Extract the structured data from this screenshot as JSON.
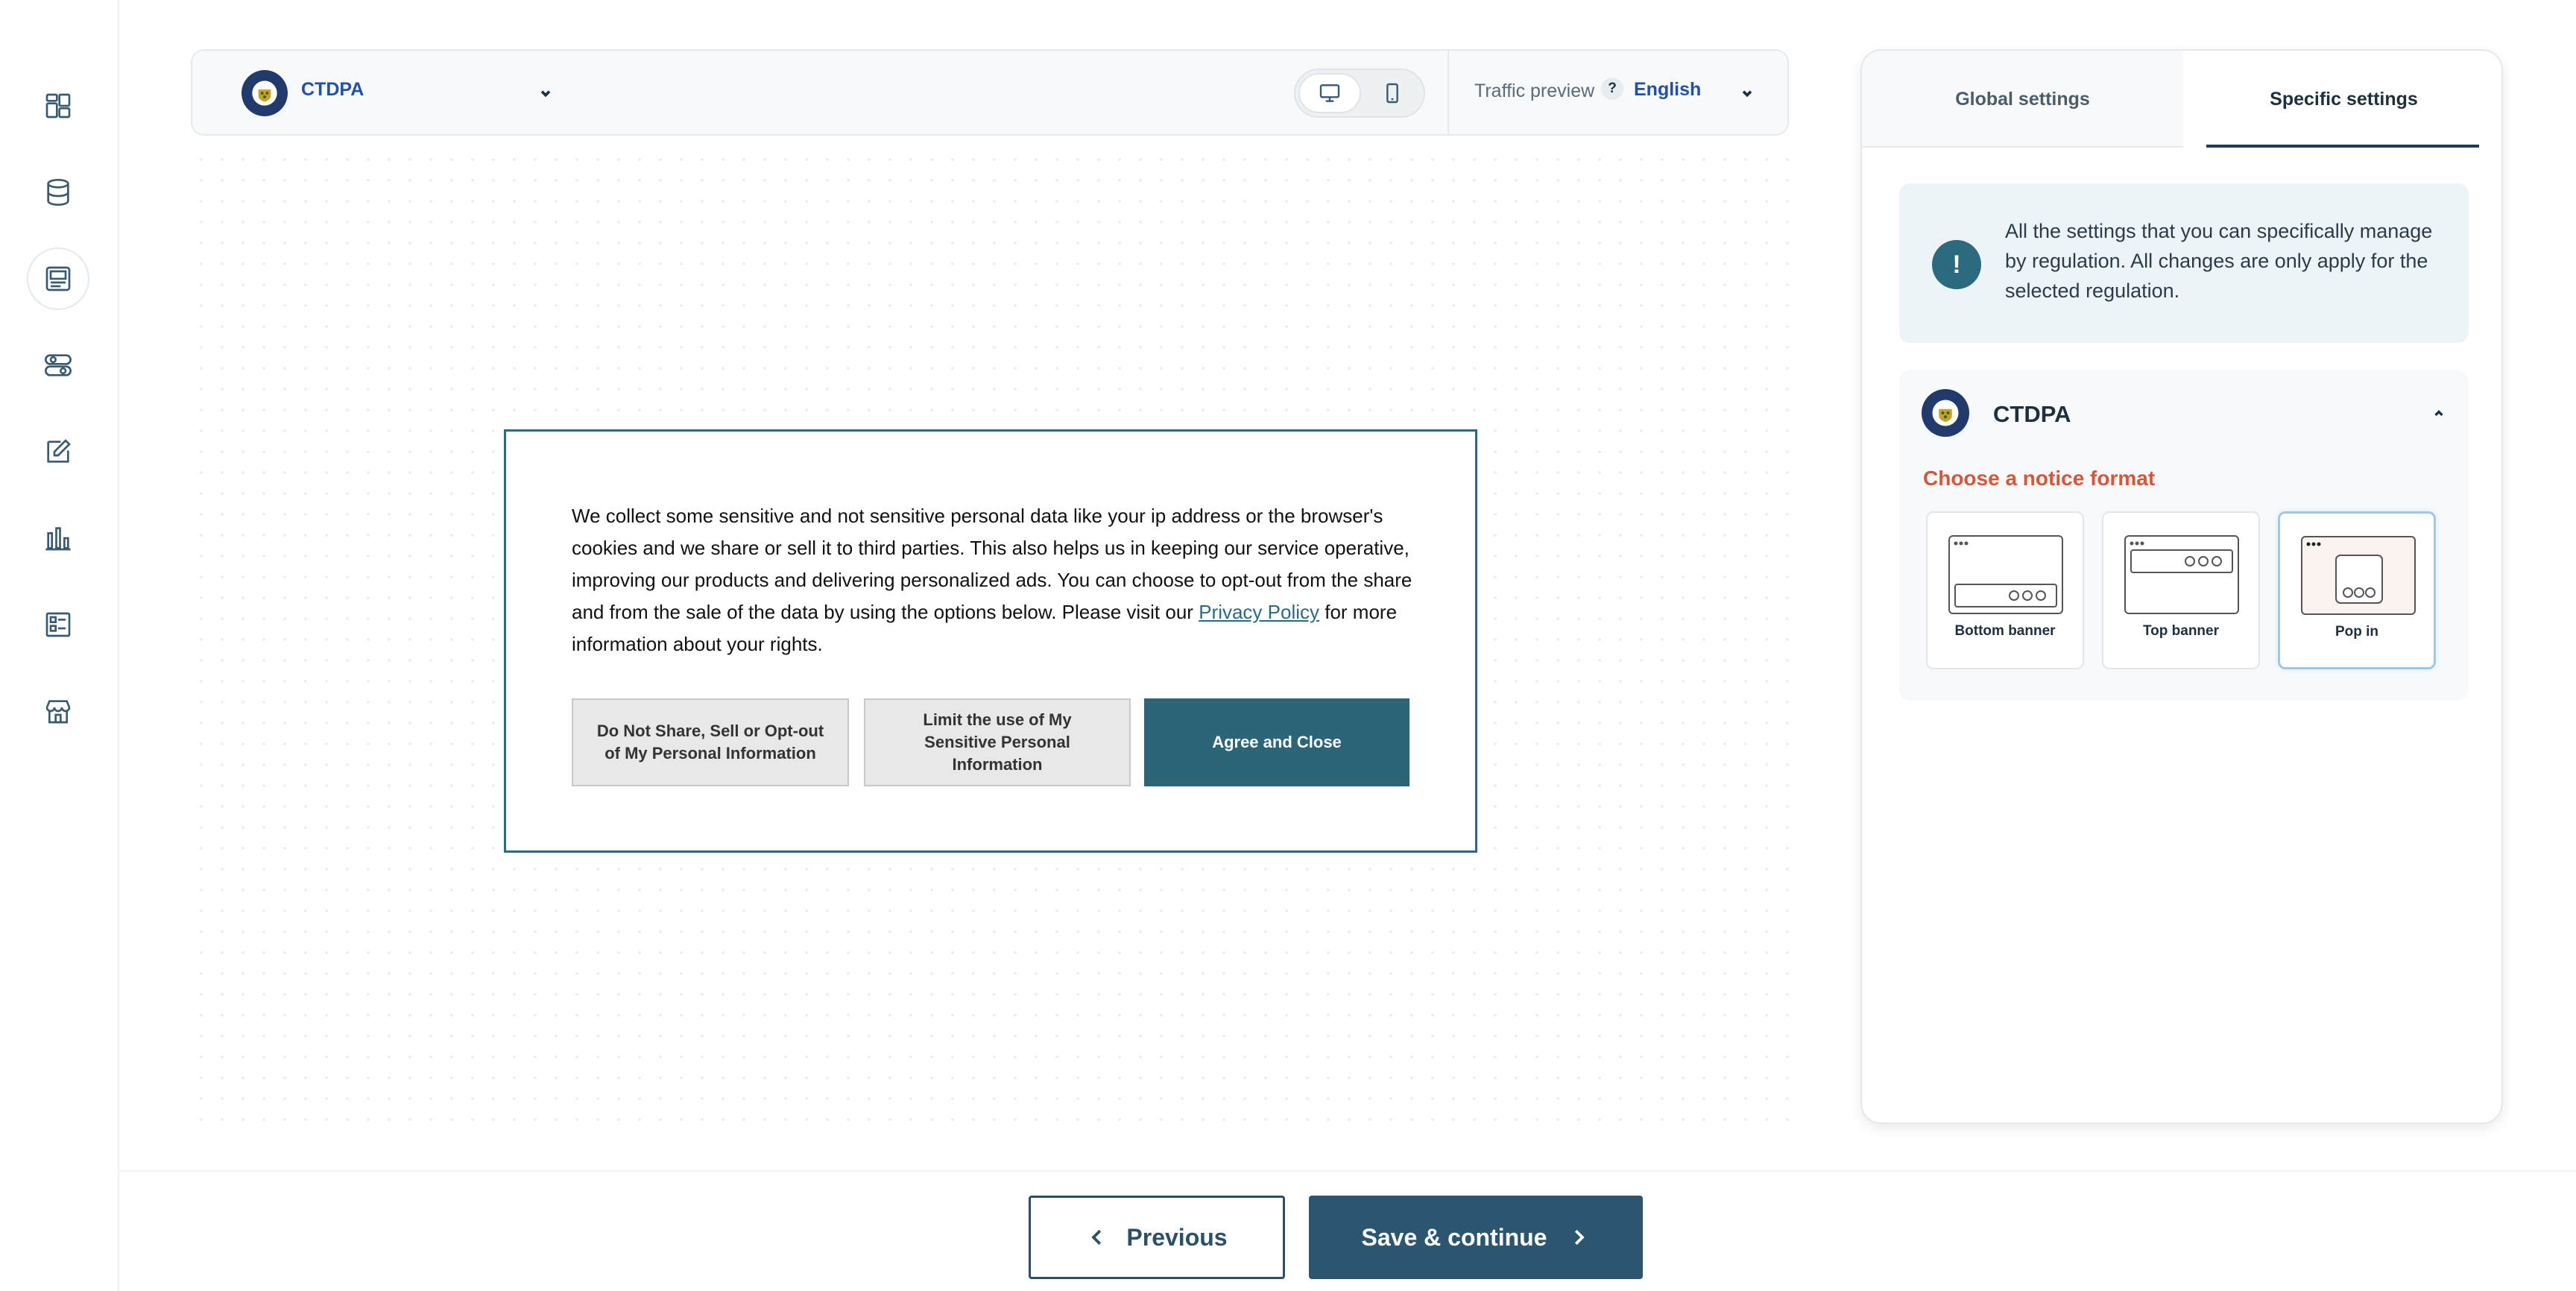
{
  "sidebar": {
    "items": [
      {
        "icon": "dashboard-icon"
      },
      {
        "icon": "database-icon"
      },
      {
        "icon": "layout-icon",
        "active": true
      },
      {
        "icon": "toggles-icon"
      },
      {
        "icon": "edit-icon"
      },
      {
        "icon": "bar-chart-icon"
      },
      {
        "icon": "checklist-icon"
      },
      {
        "icon": "store-icon"
      }
    ]
  },
  "toolbar": {
    "regulation": "CTDPA",
    "devices": [
      "desktop",
      "mobile"
    ],
    "traffic_preview_label": "Traffic preview",
    "help_symbol": "?",
    "language": "English"
  },
  "notice": {
    "text_before_link": "We collect some sensitive and not sensitive personal data like your ip address or the browser's cookies and we share or sell it to third parties. This also helps us in keeping our service operative, improving our products and delivering personalized ads. You can choose to opt-out from the share and from the sale of the data by using the options below. Please visit our ",
    "link_text": "Privacy Policy",
    "text_after_link": " for more information about your rights.",
    "buttons": {
      "opt_out": "Do Not Share, Sell or Opt-out of My Personal Information",
      "limit": "Limit the use of My Sensitive Personal Information",
      "agree": "Agree and Close"
    }
  },
  "panel": {
    "tabs": {
      "global": "Global settings",
      "specific": "Specific settings"
    },
    "info_symbol": "!",
    "info_text": "All the settings that you can specifically manage by regulation. All changes are only apply for the selected regulation.",
    "regulation_card": {
      "title": "CTDPA",
      "format_label": "Choose a notice format",
      "formats": [
        {
          "name": "Bottom banner",
          "selected": false
        },
        {
          "name": "Top banner",
          "selected": false
        },
        {
          "name": "Pop in",
          "selected": true
        }
      ]
    }
  },
  "footer": {
    "previous": "Previous",
    "save": "Save & continue"
  },
  "colors": {
    "primary": "#2c6577",
    "accent_orange": "#d4573a",
    "link_blue": "#2350a7"
  }
}
